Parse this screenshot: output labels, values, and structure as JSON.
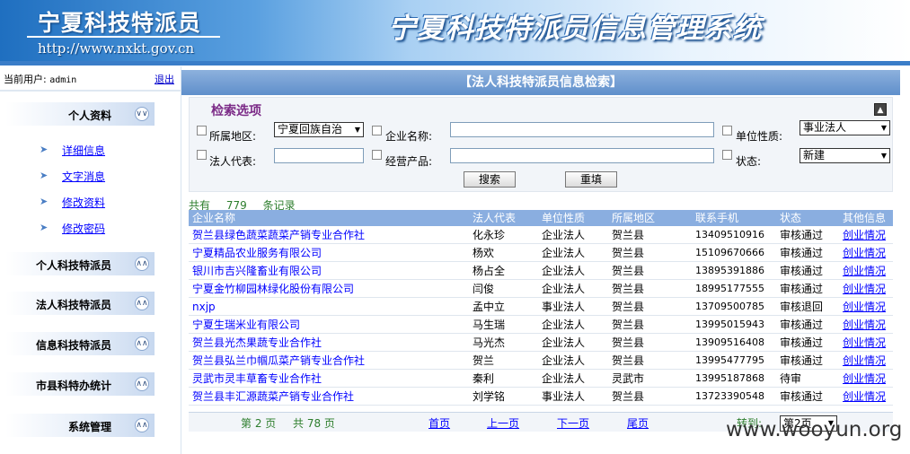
{
  "header": {
    "logo_title": "宁夏科技特派员",
    "logo_url": "http://www.nxkt.gov.cn",
    "system_title": "宁夏科技特派员信息管理系统"
  },
  "sidebar": {
    "current_user_label": "当前用户:",
    "current_user": "admin",
    "logout": "退出",
    "groups": [
      {
        "label": "个人资料",
        "toggle": "down",
        "items": [
          "详细信息",
          "文字消息",
          "修改资料",
          "修改密码"
        ]
      },
      {
        "label": "个人科技特派员",
        "toggle": "up"
      },
      {
        "label": "法人科技特派员",
        "toggle": "up"
      },
      {
        "label": "信息科技特派员",
        "toggle": "up"
      },
      {
        "label": "市县科特办统计",
        "toggle": "up"
      },
      {
        "label": "系统管理",
        "toggle": "up"
      }
    ]
  },
  "main": {
    "title": "【法人科技特派员信息检索】",
    "search": {
      "caption": "检索选项",
      "region_label": "所属地区:",
      "region_value": "宁夏回族自治",
      "company_label": "企业名称:",
      "company_value": "",
      "unit_type_label": "单位性质:",
      "unit_type_value": "事业法人",
      "legal_rep_label": "法人代表:",
      "legal_rep_value": "",
      "product_label": "经营产品:",
      "product_value": "",
      "status_label": "状态:",
      "status_value": "新建",
      "search_button": "搜索",
      "reset_button": "重填"
    },
    "count": {
      "prefix": "共有",
      "total": "779",
      "suffix": "条记录"
    },
    "table": {
      "headers": [
        "企业名称",
        "法人代表",
        "单位性质",
        "所属地区",
        "联系手机",
        "状态",
        "其他信息"
      ],
      "rows": [
        [
          "贺兰县绿色蔬菜蔬菜产销专业合作社",
          "化永珍",
          "企业法人",
          "贺兰县",
          "13409510916",
          "审核通过",
          "创业情况"
        ],
        [
          "宁夏精品农业服务有限公司",
          "杨欢",
          "企业法人",
          "贺兰县",
          "15109670666",
          "审核通过",
          "创业情况"
        ],
        [
          "银川市吉兴隆畜业有限公司",
          "杨占全",
          "企业法人",
          "贺兰县",
          "13895391886",
          "审核通过",
          "创业情况"
        ],
        [
          "宁夏金竹柳园林绿化股份有限公司",
          "闫俊",
          "企业法人",
          "贺兰县",
          "18995177555",
          "审核通过",
          "创业情况"
        ],
        [
          "nxjp",
          "孟中立",
          "事业法人",
          "贺兰县",
          "13709500785",
          "审核退回",
          "创业情况"
        ],
        [
          "宁夏生瑞米业有限公司",
          "马生瑞",
          "企业法人",
          "贺兰县",
          "13995015943",
          "审核通过",
          "创业情况"
        ],
        [
          "贺兰县光杰果蔬专业合作社",
          "马光杰",
          "企业法人",
          "贺兰县",
          "13909516408",
          "审核通过",
          "创业情况"
        ],
        [
          "贺兰县弘兰巾帼瓜菜产销专业合作社",
          "贺兰",
          "企业法人",
          "贺兰县",
          "13995477795",
          "审核通过",
          "创业情况"
        ],
        [
          "灵武市灵丰草畜专业合作社",
          "秦利",
          "企业法人",
          "灵武市",
          "13995187868",
          "待审",
          "创业情况"
        ],
        [
          "贺兰县丰汇源蔬菜产销专业合作社",
          "刘学铭",
          "事业法人",
          "贺兰县",
          "13723390548",
          "审核通过",
          "创业情况"
        ]
      ]
    },
    "pager": {
      "page_info": "第 2 页",
      "total_pages": "共 78 页",
      "first": "首页",
      "prev": "上一页",
      "next": "下一页",
      "last": "尾页",
      "jump_label": "转到:",
      "jump_value": "第2页"
    }
  },
  "watermark": "www.wooyun.org"
}
